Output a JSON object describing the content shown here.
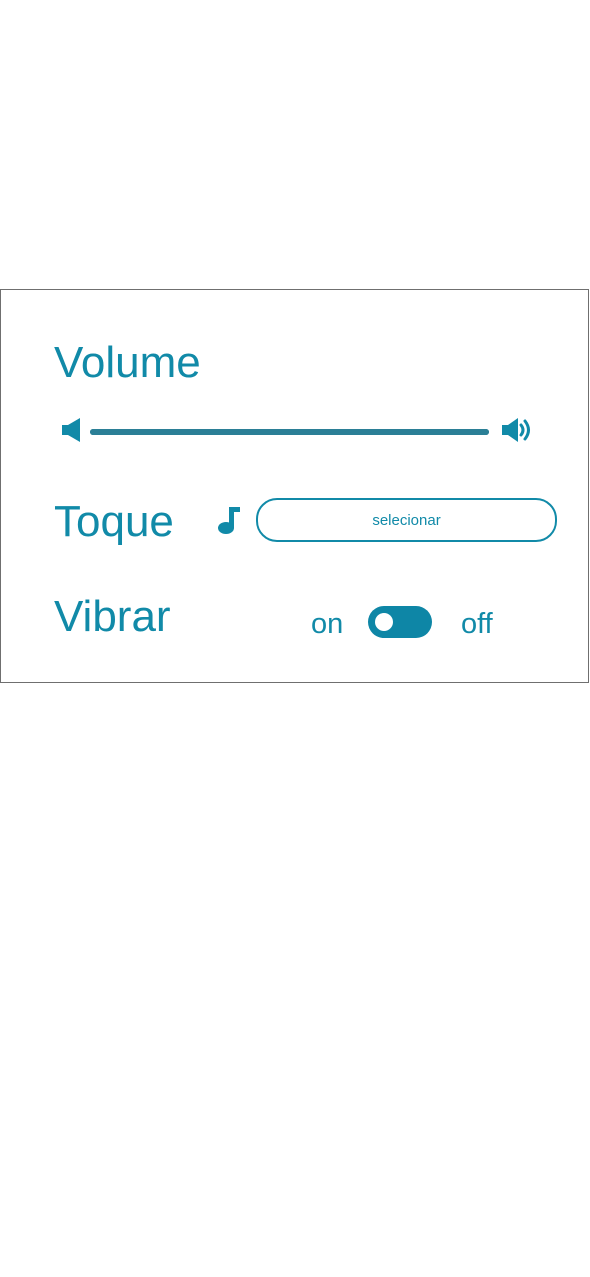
{
  "settings": {
    "volume": {
      "title": "Volume",
      "level": 1.0,
      "low_icon": "volume-low-icon",
      "high_icon": "volume-high-icon"
    },
    "ringtone": {
      "title": "Toque",
      "icon": "music-note-icon",
      "select_label": "selecionar"
    },
    "vibrate": {
      "title": "Vibrar",
      "on_label": "on",
      "off_label": "off",
      "state": "on"
    }
  },
  "colors": {
    "accent": "#118aa8",
    "slider": "#2b7f96",
    "toggle": "#0e86a6",
    "border": "#6f6f6f"
  }
}
